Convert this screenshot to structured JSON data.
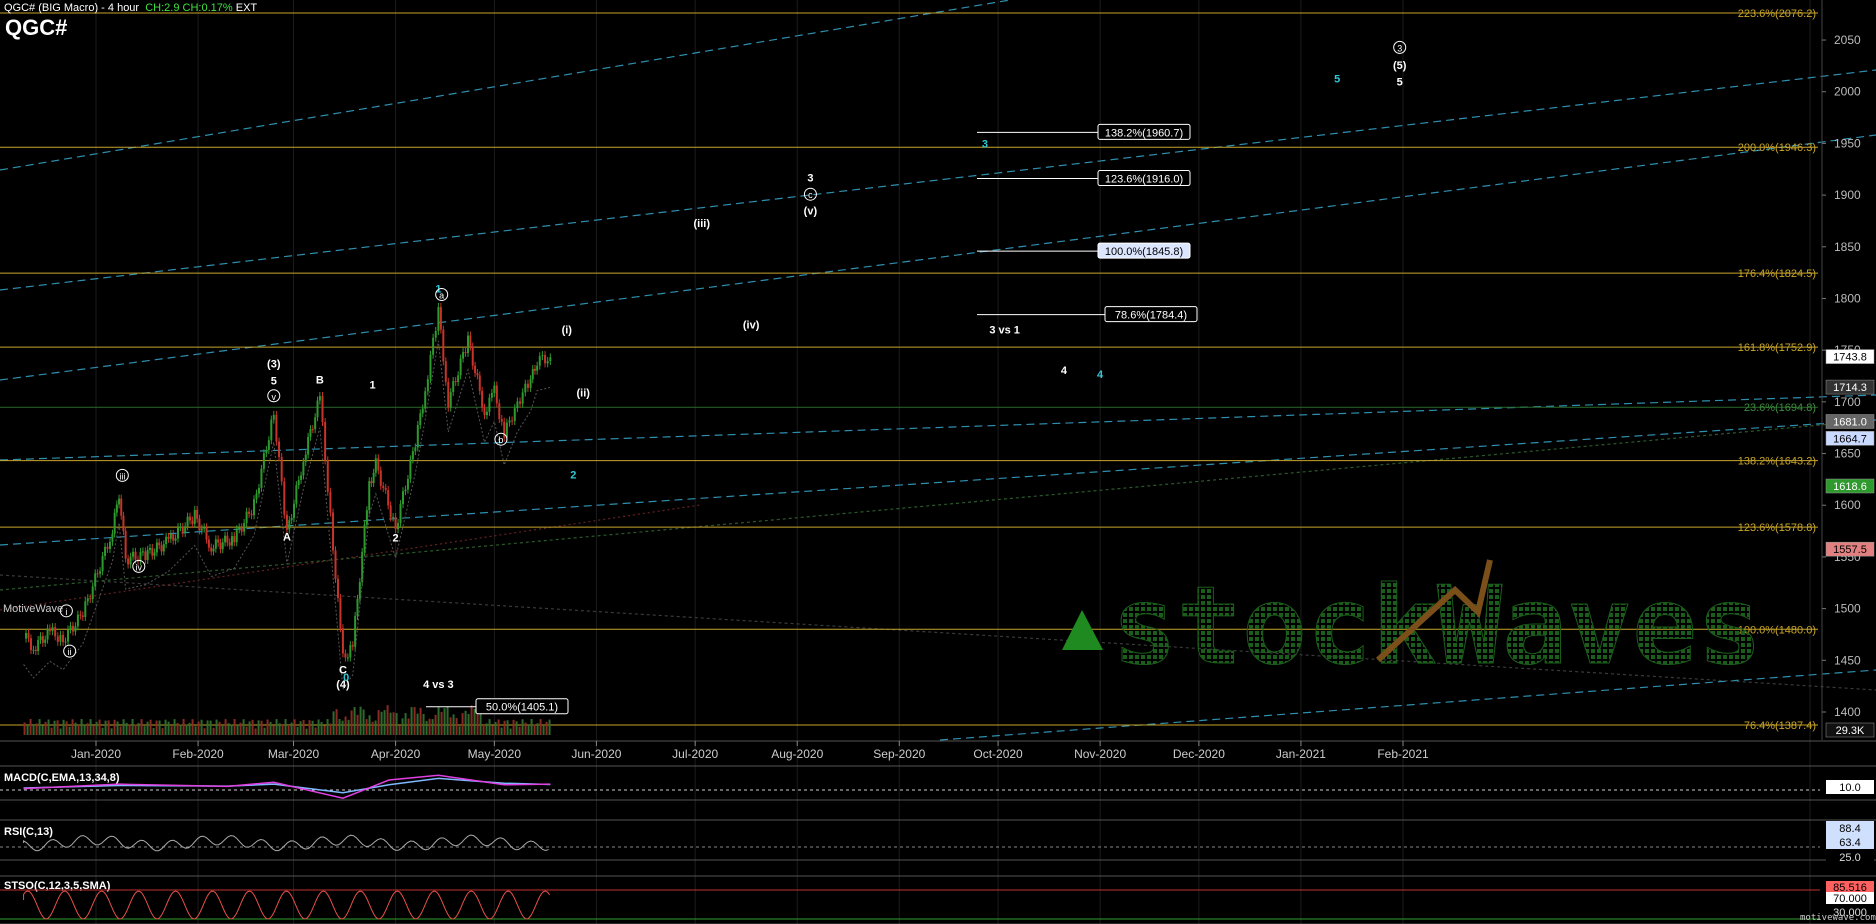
{
  "header": {
    "title_line": "QGC# (BIG Macro) - 4 hour",
    "change": "CH:2.9",
    "change_pct": "CH:0.17%",
    "session": "EXT",
    "symbol": "QGC#"
  },
  "branding": {
    "watermark": "stockWaves",
    "platform": "MotiveWave",
    "footer_url": "motivewave.com"
  },
  "colors": {
    "background": "#000000",
    "fib_line": "#c8a52a",
    "channel_line": "#2f8fae",
    "wave_cyan": "#2fc8d6",
    "up_candle": "#2e9a2e",
    "down_candle": "#c8342a",
    "macd_line": "#e040e0",
    "macd_signal": "#7fb8ff",
    "stoch_line": "#e8504a"
  },
  "chart_data": [
    {
      "type": "candlestick",
      "panel": "price",
      "title": "QGC# (BIG Macro) - 4 hour",
      "ylim": [
        1360,
        2080
      ],
      "y_ticks": [
        1400,
        1450,
        1500,
        1550,
        1600,
        1650,
        1700,
        1750,
        1800,
        1850,
        1900,
        1950,
        2000,
        2050
      ],
      "x_tick_labels": [
        "Jan-2020",
        "Feb-2020",
        "Mar-2020",
        "Apr-2020",
        "May-2020",
        "Jun-2020",
        "Jul-2020",
        "Aug-2020",
        "Sep-2020",
        "Oct-2020",
        "Nov-2020",
        "Dec-2020",
        "Jan-2021",
        "Feb-2021"
      ],
      "price_path": [
        [
          "2019-12-10",
          1475
        ],
        [
          "2019-12-13",
          1462
        ],
        [
          "2019-12-18",
          1478
        ],
        [
          "2019-12-22",
          1470
        ],
        [
          "2019-12-28",
          1495
        ],
        [
          "2020-01-06",
          1575
        ],
        [
          "2020-01-08",
          1612
        ],
        [
          "2020-01-10",
          1548
        ],
        [
          "2020-01-16",
          1552
        ],
        [
          "2020-01-23",
          1565
        ],
        [
          "2020-01-31",
          1590
        ],
        [
          "2020-02-05",
          1560
        ],
        [
          "2020-02-12",
          1568
        ],
        [
          "2020-02-18",
          1600
        ],
        [
          "2020-02-24",
          1690
        ],
        [
          "2020-02-28",
          1572
        ],
        [
          "2020-03-04",
          1645
        ],
        [
          "2020-03-09",
          1704
        ],
        [
          "2020-03-13",
          1560
        ],
        [
          "2020-03-16",
          1451
        ],
        [
          "2020-03-19",
          1465
        ],
        [
          "2020-03-24",
          1620
        ],
        [
          "2020-03-26",
          1640
        ],
        [
          "2020-04-01",
          1578
        ],
        [
          "2020-04-07",
          1660
        ],
        [
          "2020-04-10",
          1712
        ],
        [
          "2020-04-14",
          1788
        ],
        [
          "2020-04-17",
          1700
        ],
        [
          "2020-04-23",
          1760
        ],
        [
          "2020-04-28",
          1690
        ],
        [
          "2020-05-01",
          1710
        ],
        [
          "2020-05-04",
          1668
        ],
        [
          "2020-05-08",
          1700
        ],
        [
          "2020-05-12",
          1720
        ],
        [
          "2020-05-14",
          1740
        ],
        [
          "2020-05-18",
          1743
        ]
      ],
      "fib_levels": [
        {
          "label": "223.6%(2076.2)",
          "value": 2076.2
        },
        {
          "label": "200.0%(1946.3)",
          "value": 1946.3
        },
        {
          "label": "176.4%(1824.5)",
          "value": 1824.5
        },
        {
          "label": "161.8%(1752.9)",
          "value": 1752.9
        },
        {
          "label": "23.6%(1694.8)",
          "value": 1694.8
        },
        {
          "label": "138.2%(1643.2)",
          "value": 1643.2
        },
        {
          "label": "123.6%(1578.8)",
          "value": 1578.8
        },
        {
          "label": "100.0%(1480.0)",
          "value": 1480.0
        },
        {
          "label": "76.4%(1387.4)",
          "value": 1387.4
        }
      ],
      "target_boxes": [
        {
          "label": "138.2%(1960.7)",
          "value": 1960.7
        },
        {
          "label": "123.6%(1916.0)",
          "value": 1916.0
        },
        {
          "label": "100.0%(1845.8)",
          "value": 1845.8
        },
        {
          "label": "78.6%(1784.4)",
          "value": 1784.4
        },
        {
          "label": "50.0%(1405.1)",
          "value": 1405.1
        }
      ],
      "price_tags": [
        {
          "label": "1743.8",
          "value": 1743.8,
          "color": "#ffffff",
          "text": "#000000"
        },
        {
          "label": "1714.3",
          "value": 1714.3,
          "color": "#333333",
          "text": "#ffffff"
        },
        {
          "label": "1681.0",
          "value": 1681.0,
          "color": "#666666",
          "text": "#ffffff"
        },
        {
          "label": "1664.7",
          "value": 1664.7,
          "color": "#c9d9ff",
          "text": "#000000"
        },
        {
          "label": "1618.6",
          "value": 1618.6,
          "color": "#2e9a2e",
          "text": "#ffffff"
        },
        {
          "label": "1557.5",
          "value": 1557.5,
          "color": "#e08080",
          "text": "#000000"
        },
        {
          "label": "29.3K",
          "value": 1367,
          "color": "#111111",
          "text": "#ffffff"
        }
      ],
      "wave_labels": [
        {
          "text": "i",
          "circle": true,
          "x": "2019-12-23",
          "y": 1494,
          "color": "#ffffff"
        },
        {
          "text": "ii",
          "circle": true,
          "x": "2019-12-24",
          "y": 1455,
          "color": "#ffffff"
        },
        {
          "text": "iii",
          "circle": true,
          "x": "2020-01-09",
          "y": 1625,
          "color": "#ffffff"
        },
        {
          "text": "iv",
          "circle": true,
          "x": "2020-01-14",
          "y": 1537,
          "color": "#ffffff"
        },
        {
          "text": "v",
          "circle": true,
          "x": "2020-02-24",
          "y": 1702,
          "color": "#ffffff"
        },
        {
          "text": "(3)",
          "circle": false,
          "x": "2020-02-24",
          "y": 1733,
          "color": "#ffffff"
        },
        {
          "text": "5",
          "circle": false,
          "x": "2020-02-24",
          "y": 1717,
          "color": "#ffffff"
        },
        {
          "text": "A",
          "circle": false,
          "x": "2020-02-28",
          "y": 1566,
          "color": "#ffffff"
        },
        {
          "text": "B",
          "circle": false,
          "x": "2020-03-09",
          "y": 1718,
          "color": "#ffffff"
        },
        {
          "text": "C",
          "circle": false,
          "x": "2020-03-16",
          "y": 1437,
          "color": "#ffffff"
        },
        {
          "text": "(4)",
          "circle": false,
          "x": "2020-03-16",
          "y": 1423,
          "color": "#ffffff"
        },
        {
          "text": "0",
          "circle": false,
          "x": "2020-03-17",
          "y": 1430,
          "color": "#2fc8d6"
        },
        {
          "text": "1",
          "circle": false,
          "x": "2020-03-25",
          "y": 1713,
          "color": "#ffffff"
        },
        {
          "text": "2",
          "circle": false,
          "x": "2020-04-01",
          "y": 1565,
          "color": "#ffffff"
        },
        {
          "text": "1",
          "circle": false,
          "x": "2020-04-14",
          "y": 1806,
          "color": "#2fc8d6"
        },
        {
          "text": "a",
          "circle": true,
          "x": "2020-04-15",
          "y": 1800,
          "color": "#ffffff"
        },
        {
          "text": "b",
          "circle": true,
          "x": "2020-05-03",
          "y": 1660,
          "color": "#ffffff"
        },
        {
          "text": "(i)",
          "circle": false,
          "x": "2020-05-23",
          "y": 1766,
          "color": "#ffffff"
        },
        {
          "text": "(ii)",
          "circle": false,
          "x": "2020-05-28",
          "y": 1705,
          "color": "#ffffff"
        },
        {
          "text": "2",
          "circle": false,
          "x": "2020-05-25",
          "y": 1626,
          "color": "#2fc8d6"
        },
        {
          "text": "(iii)",
          "circle": false,
          "x": "2020-07-03",
          "y": 1869,
          "color": "#ffffff"
        },
        {
          "text": "(iv)",
          "circle": false,
          "x": "2020-07-18",
          "y": 1771,
          "color": "#ffffff"
        },
        {
          "text": "3",
          "circle": false,
          "x": "2020-08-05",
          "y": 1913,
          "color": "#ffffff"
        },
        {
          "text": "c",
          "circle": true,
          "x": "2020-08-05",
          "y": 1897,
          "color": "#ffffff"
        },
        {
          "text": "(v)",
          "circle": false,
          "x": "2020-08-05",
          "y": 1881,
          "color": "#ffffff"
        },
        {
          "text": "3",
          "circle": false,
          "x": "2020-09-27",
          "y": 1946,
          "color": "#2fc8d6"
        },
        {
          "text": "3 vs 1",
          "circle": false,
          "x": "2020-10-03",
          "y": 1766,
          "color": "#ffffff"
        },
        {
          "text": "4",
          "circle": false,
          "x": "2020-10-21",
          "y": 1727,
          "color": "#ffffff"
        },
        {
          "text": "4",
          "circle": false,
          "x": "2020-11-01",
          "y": 1723,
          "color": "#2fc8d6"
        },
        {
          "text": "4 vs 3",
          "circle": false,
          "x": "2020-04-14",
          "y": 1423,
          "color": "#ffffff"
        },
        {
          "text": "5",
          "circle": false,
          "x": "2021-01-12",
          "y": 2009,
          "color": "#2fc8d6"
        },
        {
          "text": "3",
          "circle": true,
          "x": "2021-01-31",
          "y": 2039,
          "color": "#ffffff"
        },
        {
          "text": "(5)",
          "circle": false,
          "x": "2021-01-31",
          "y": 2022,
          "color": "#ffffff"
        },
        {
          "text": "5",
          "circle": false,
          "x": "2021-01-31",
          "y": 2006,
          "color": "#ffffff"
        }
      ]
    },
    {
      "type": "line",
      "panel": "macd",
      "title": "MACD(C,EMA,13,34,8)",
      "tag": "10.0",
      "macd": [
        [
          "2019-12-10",
          -2
        ],
        [
          "2020-01-08",
          12
        ],
        [
          "2020-02-10",
          5
        ],
        [
          "2020-02-24",
          18
        ],
        [
          "2020-03-16",
          -32
        ],
        [
          "2020-03-30",
          25
        ],
        [
          "2020-04-14",
          40
        ],
        [
          "2020-05-04",
          10
        ],
        [
          "2020-05-18",
          12
        ]
      ],
      "signal": [
        [
          "2019-12-10",
          0
        ],
        [
          "2020-01-08",
          8
        ],
        [
          "2020-02-10",
          6
        ],
        [
          "2020-02-24",
          12
        ],
        [
          "2020-03-16",
          -15
        ],
        [
          "2020-03-30",
          10
        ],
        [
          "2020-04-14",
          30
        ],
        [
          "2020-05-04",
          15
        ],
        [
          "2020-05-18",
          11
        ]
      ]
    },
    {
      "type": "line",
      "panel": "rsi",
      "title": "RSI(C,13)",
      "y_ticks": [
        25.0
      ],
      "tags": [
        {
          "label": "88.4",
          "value": 88.4
        },
        {
          "label": "63.4",
          "value": 63.4
        },
        {
          "label": "25.0",
          "value": 25.0
        }
      ]
    },
    {
      "type": "line",
      "panel": "stochastic",
      "title": "STSO(C,12,3,5,SMA)",
      "tags": [
        {
          "label": "85.516",
          "value": 85.5
        },
        {
          "label": "70.000",
          "value": 70
        },
        {
          "label": "30.000",
          "value": 30
        }
      ]
    }
  ]
}
